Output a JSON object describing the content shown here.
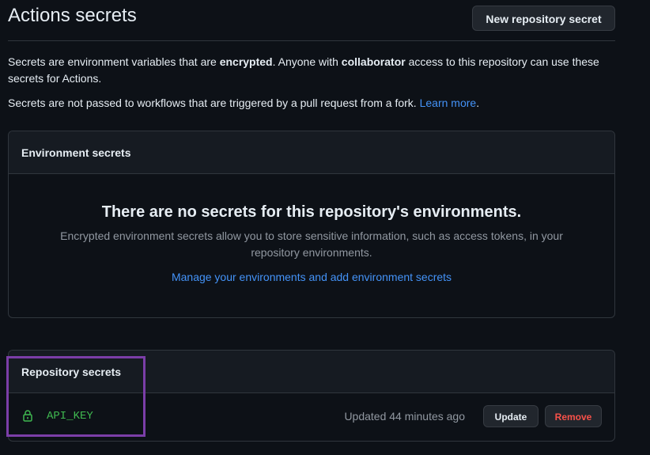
{
  "header": {
    "title": "Actions secrets",
    "new_secret_label": "New repository secret"
  },
  "description": {
    "line1_part1": "Secrets are environment variables that are ",
    "line1_bold1": "encrypted",
    "line1_part2": ". Anyone with ",
    "line1_bold2": "collaborator",
    "line1_part3": " access to this repository can use these secrets for Actions.",
    "line2_text": "Secrets are not passed to workflows that are triggered by a pull request from a fork. ",
    "line2_link": "Learn more",
    "line2_end": "."
  },
  "environment_secrets": {
    "header": "Environment secrets",
    "blank_title": "There are no secrets for this repository's environments.",
    "blank_description": "Encrypted environment secrets allow you to store sensitive information, such as access tokens, in your repository environments.",
    "manage_link": "Manage your environments and add environment secrets"
  },
  "repository_secrets": {
    "header": "Repository secrets",
    "items": [
      {
        "icon": "lock-icon",
        "name": "API_KEY",
        "updated": "Updated 44 minutes ago",
        "update_label": "Update",
        "remove_label": "Remove"
      }
    ]
  },
  "colors": {
    "background": "#0d1117",
    "panel_header": "#161b22",
    "border": "#30363d",
    "link": "#4493f8",
    "secret_name": "#3fb950",
    "danger": "#f85149",
    "highlight": "#7b3ea8"
  }
}
